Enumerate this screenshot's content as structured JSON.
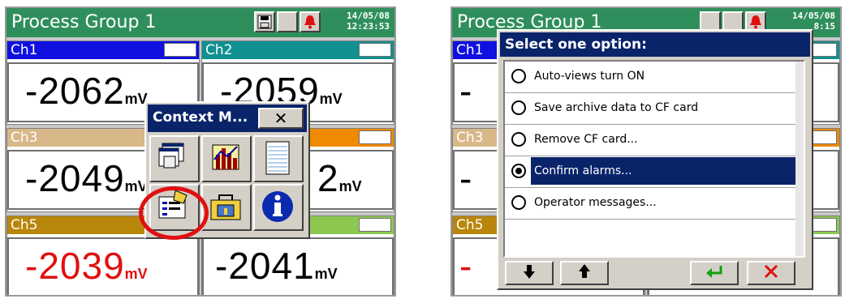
{
  "left_screen": {
    "title": "Process Group 1",
    "date": "14/05/08",
    "time": "12:23:53",
    "channels": [
      {
        "name": "Ch1",
        "value": "-2062",
        "unit": "mV",
        "header_color": "#1010e0",
        "value_color": "#000000"
      },
      {
        "name": "Ch2",
        "value": "-2059",
        "unit": "mV",
        "header_color": "#109090",
        "value_color": "#000000"
      },
      {
        "name": "Ch3",
        "value": "-2049",
        "unit": "mV",
        "header_color": "#d8b888",
        "value_color": "#000000"
      },
      {
        "name": "",
        "value": "2",
        "unit": "mV",
        "header_color": "#f08a00",
        "value_color": "#000000"
      },
      {
        "name": "Ch5",
        "value": "-2039",
        "unit": "mV",
        "header_color": "#b8860b",
        "value_color": "#e01010"
      },
      {
        "name": "",
        "value": "-2041",
        "unit": "mV",
        "header_color": "#8cc850",
        "value_color": "#000000"
      }
    ],
    "context_menu": {
      "title": "Context M...",
      "close_label": "✕",
      "icons": [
        "window-list-icon",
        "chart-icon",
        "notepad-icon",
        "operator-message-icon",
        "toolbox-icon",
        "info-icon"
      ]
    }
  },
  "right_screen": {
    "title_partial": "Process Group 1",
    "date": "14/05/08",
    "time": "8:15",
    "dialog": {
      "title": "Select one option:",
      "options": [
        {
          "label": "Auto-views turn ON",
          "selected": false
        },
        {
          "label": "Save archive data to CF card",
          "selected": false
        },
        {
          "label": "Remove CF card...",
          "selected": false
        },
        {
          "label": "Confirm alarms...",
          "selected": true
        },
        {
          "label": "Operator messages...",
          "selected": false
        }
      ],
      "buttons": [
        "down-arrow",
        "up-arrow",
        "enter",
        "cancel"
      ]
    },
    "channels_partial": [
      "Ch1",
      "Ch3",
      "Ch5"
    ]
  },
  "colors": {
    "title_bar": "#2f8f5c",
    "dialog_title": "#0a246a",
    "highlight_ring": "#e01010"
  }
}
